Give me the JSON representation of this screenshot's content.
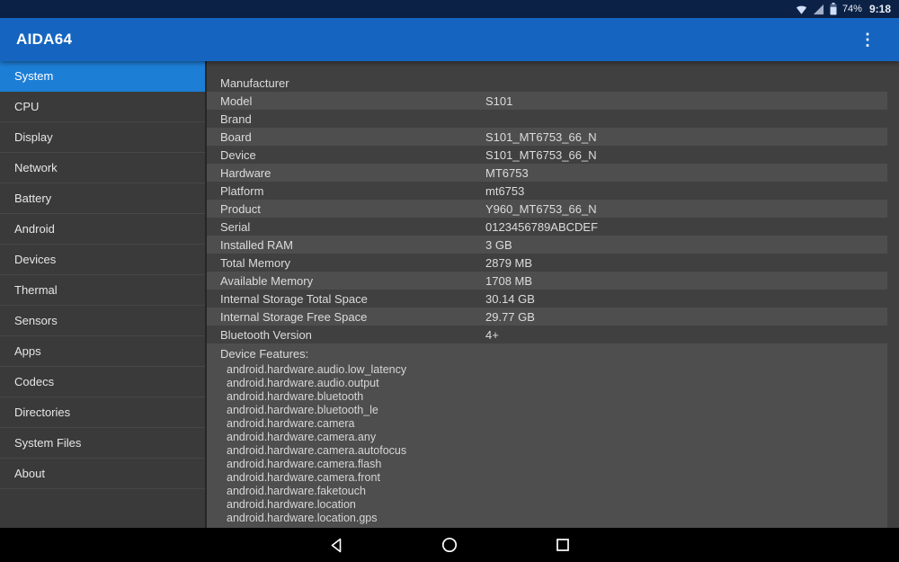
{
  "status_bar": {
    "time": "9:18",
    "battery_percent": "74%",
    "icons": [
      "wifi-icon",
      "cellular-signal-icon",
      "battery-icon"
    ]
  },
  "app_bar": {
    "title": "AIDA64",
    "overflow_icon": "⋮"
  },
  "sidebar": {
    "items": [
      {
        "label": "System",
        "selected": true
      },
      {
        "label": "CPU",
        "selected": false
      },
      {
        "label": "Display",
        "selected": false
      },
      {
        "label": "Network",
        "selected": false
      },
      {
        "label": "Battery",
        "selected": false
      },
      {
        "label": "Android",
        "selected": false
      },
      {
        "label": "Devices",
        "selected": false
      },
      {
        "label": "Thermal",
        "selected": false
      },
      {
        "label": "Sensors",
        "selected": false
      },
      {
        "label": "Apps",
        "selected": false
      },
      {
        "label": "Codecs",
        "selected": false
      },
      {
        "label": "Directories",
        "selected": false
      },
      {
        "label": "System Files",
        "selected": false
      },
      {
        "label": "About",
        "selected": false
      }
    ]
  },
  "content": {
    "rows": [
      {
        "label": "Manufacturer",
        "value": ""
      },
      {
        "label": "Model",
        "value": "S101"
      },
      {
        "label": "Brand",
        "value": ""
      },
      {
        "label": "Board",
        "value": "S101_MT6753_66_N"
      },
      {
        "label": "Device",
        "value": "S101_MT6753_66_N"
      },
      {
        "label": "Hardware",
        "value": "MT6753"
      },
      {
        "label": "Platform",
        "value": "mt6753"
      },
      {
        "label": "Product",
        "value": "Y960_MT6753_66_N"
      },
      {
        "label": "Serial",
        "value": "0123456789ABCDEF"
      },
      {
        "label": "Installed RAM",
        "value": "3 GB"
      },
      {
        "label": "Total Memory",
        "value": "2879 MB"
      },
      {
        "label": "Available Memory",
        "value": "1708 MB"
      },
      {
        "label": "Internal Storage Total Space",
        "value": "30.14 GB"
      },
      {
        "label": "Internal Storage Free Space",
        "value": "29.77 GB"
      },
      {
        "label": "Bluetooth Version",
        "value": "4+"
      }
    ],
    "features_header": "Device Features:",
    "features": [
      "android.hardware.audio.low_latency",
      "android.hardware.audio.output",
      "android.hardware.bluetooth",
      "android.hardware.bluetooth_le",
      "android.hardware.camera",
      "android.hardware.camera.any",
      "android.hardware.camera.autofocus",
      "android.hardware.camera.flash",
      "android.hardware.camera.front",
      "android.hardware.faketouch",
      "android.hardware.location",
      "android.hardware.location.gps"
    ]
  },
  "nav_bar": {
    "buttons": [
      "back",
      "home",
      "recents"
    ]
  },
  "colors": {
    "status_bar_bg": "#0c2146",
    "app_bar_bg": "#1565c0",
    "selected_item_bg": "#1d7ed6",
    "sidebar_bg": "#3a3a3a",
    "content_bg": "#404040",
    "stripe_bg": "#4e4e4e",
    "nav_bar_bg": "#000000"
  }
}
